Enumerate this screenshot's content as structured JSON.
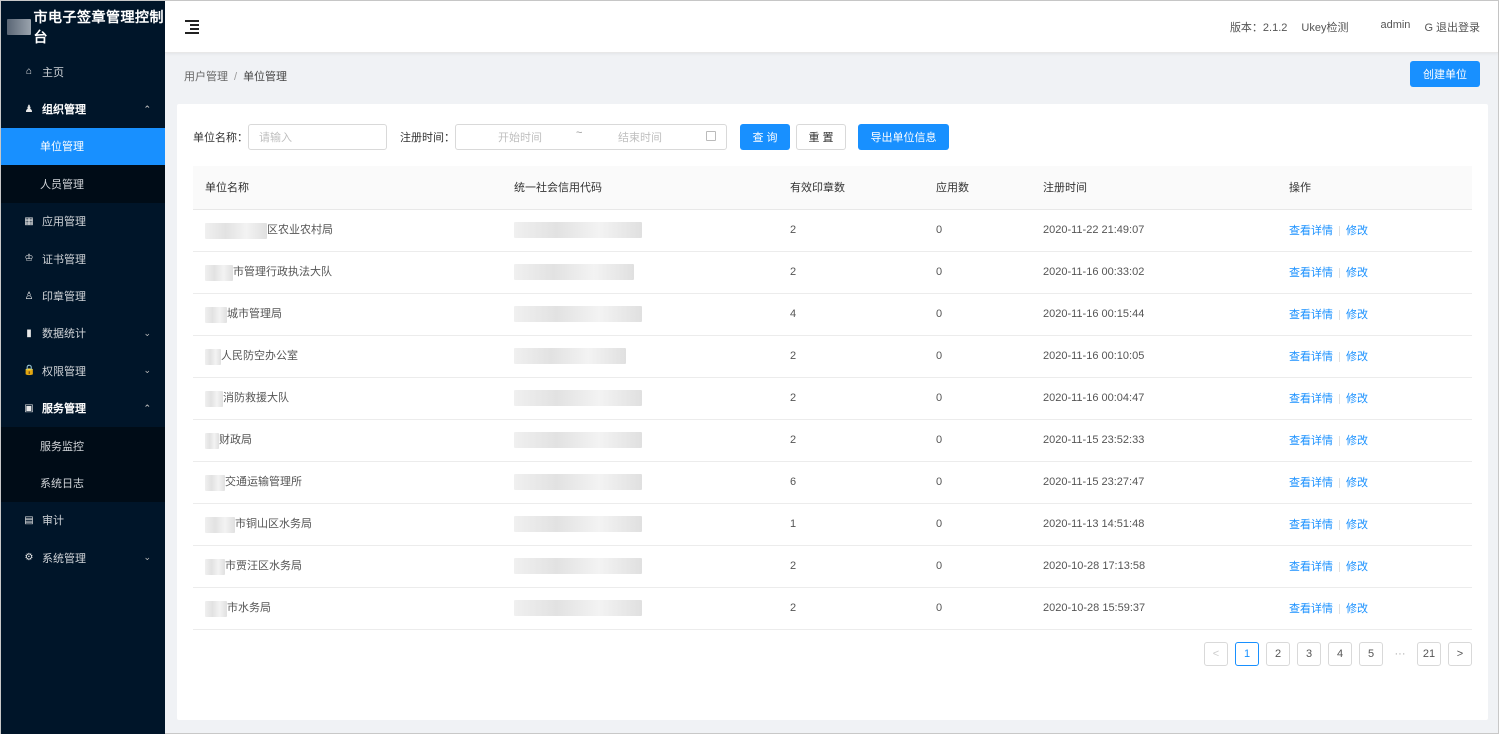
{
  "app": {
    "title": "市电子签章管理控制台"
  },
  "sidebar": {
    "items": [
      {
        "label": "主页",
        "icon": "home-icon",
        "glyph": "⌂"
      },
      {
        "label": "组织管理",
        "icon": "team-icon",
        "glyph": "♟",
        "arrow": "⌃"
      },
      {
        "label": "单位管理"
      },
      {
        "label": "人员管理"
      },
      {
        "label": "应用管理",
        "icon": "apps-icon",
        "glyph": "▦"
      },
      {
        "label": "证书管理",
        "icon": "certificate-icon",
        "glyph": "♔"
      },
      {
        "label": "印章管理",
        "icon": "seal-icon",
        "glyph": "♙"
      },
      {
        "label": "数据统计",
        "icon": "bar-chart-icon",
        "glyph": "▮",
        "arrow": "⌄"
      },
      {
        "label": "权限管理",
        "icon": "lock-icon",
        "glyph": "🔒",
        "arrow": "⌄"
      },
      {
        "label": "服务管理",
        "icon": "bookmark-icon",
        "glyph": "▣",
        "arrow": "⌃"
      },
      {
        "label": "服务监控"
      },
      {
        "label": "系统日志"
      },
      {
        "label": "审计",
        "icon": "audit-icon",
        "glyph": "▤"
      },
      {
        "label": "系统管理",
        "icon": "settings-icon",
        "glyph": "⚙",
        "arrow": "⌄"
      }
    ]
  },
  "header": {
    "version": "版本：2.1.2",
    "ukey": "Ukey检测",
    "user": "admin",
    "logout": "退出登录",
    "logout_glyph": "G"
  },
  "breadcrumb": {
    "parent": "用户管理",
    "sep": "/",
    "current": "单位管理"
  },
  "create_button": "创建单位",
  "filters": {
    "name_label": "单位名称：",
    "name_placeholder": "请输入",
    "time_label": "注册时间：",
    "start_placeholder": "开始时间",
    "range_sep": "~",
    "end_placeholder": "结束时间",
    "query": "查 询",
    "reset": "重 置",
    "export": "导出单位信息"
  },
  "table": {
    "headers": [
      "单位名称",
      "统一社会信用代码",
      "有效印章数",
      "应用数",
      "注册时间",
      "操作"
    ],
    "rows": [
      {
        "name": "区农业农村局",
        "seals": "2",
        "apps": "0",
        "time": "2020-11-22 21:49:07"
      },
      {
        "name": "市管理行政执法大队",
        "seals": "2",
        "apps": "0",
        "time": "2020-11-16 00:33:02"
      },
      {
        "name": "城市管理局",
        "seals": "4",
        "apps": "0",
        "time": "2020-11-16 00:15:44"
      },
      {
        "name": "人民防空办公室",
        "seals": "2",
        "apps": "0",
        "time": "2020-11-16 00:10:05"
      },
      {
        "name": "消防救援大队",
        "seals": "2",
        "apps": "0",
        "time": "2020-11-16 00:04:47"
      },
      {
        "name": "财政局",
        "seals": "2",
        "apps": "0",
        "time": "2020-11-15 23:52:33"
      },
      {
        "name": "交通运输管理所",
        "seals": "6",
        "apps": "0",
        "time": "2020-11-15 23:27:47"
      },
      {
        "name": "市铜山区水务局",
        "seals": "1",
        "apps": "0",
        "time": "2020-11-13 14:51:48"
      },
      {
        "name": "市贾汪区水务局",
        "seals": "2",
        "apps": "0",
        "time": "2020-10-28 17:13:58"
      },
      {
        "name": "市水务局",
        "seals": "2",
        "apps": "0",
        "time": "2020-10-28 15:59:37"
      }
    ],
    "action_view": "查看详情",
    "action_edit": "修改"
  },
  "pagination": {
    "prev": "<",
    "pages": [
      "1",
      "2",
      "3",
      "4",
      "5"
    ],
    "ellipsis": "···",
    "last": "21",
    "next": ">",
    "current": "1"
  }
}
